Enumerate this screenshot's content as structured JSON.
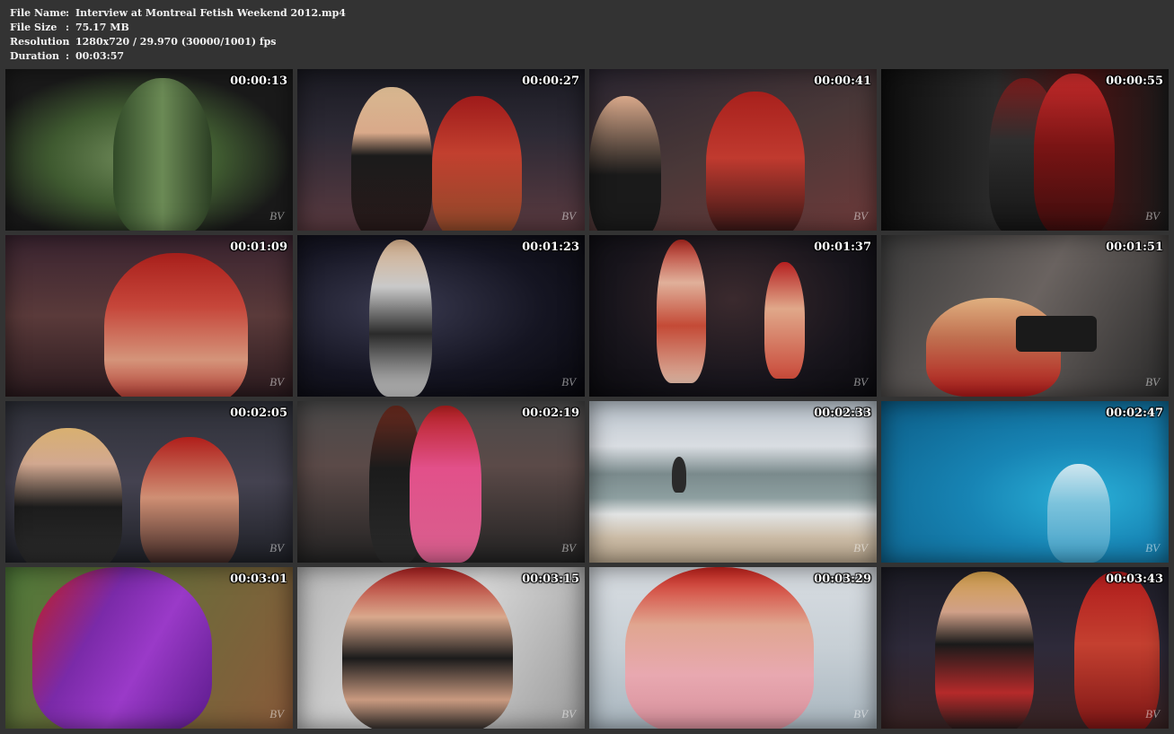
{
  "meta": {
    "file_name_label": "File Name",
    "file_name": "Interview at Montreal Fetish Weekend 2012.mp4",
    "file_size_label": "File Size",
    "file_size": "75.17 MB",
    "resolution_label": "Resolution",
    "resolution": "1280x720 / 29.970 (30000/1001) fps",
    "duration_label": "Duration",
    "duration": "00:03:57",
    "separator": ":"
  },
  "thumbnails": [
    {
      "time": "00:00:13"
    },
    {
      "time": "00:00:27"
    },
    {
      "time": "00:00:41"
    },
    {
      "time": "00:00:55"
    },
    {
      "time": "00:01:09"
    },
    {
      "time": "00:01:23"
    },
    {
      "time": "00:01:37"
    },
    {
      "time": "00:01:51"
    },
    {
      "time": "00:02:05"
    },
    {
      "time": "00:02:19"
    },
    {
      "time": "00:02:33"
    },
    {
      "time": "00:02:47"
    },
    {
      "time": "00:03:01"
    },
    {
      "time": "00:03:15"
    },
    {
      "time": "00:03:29"
    },
    {
      "time": "00:03:43"
    }
  ],
  "watermark": "BV",
  "colors": {
    "background": "#333333",
    "text": "#f2f2f2"
  }
}
